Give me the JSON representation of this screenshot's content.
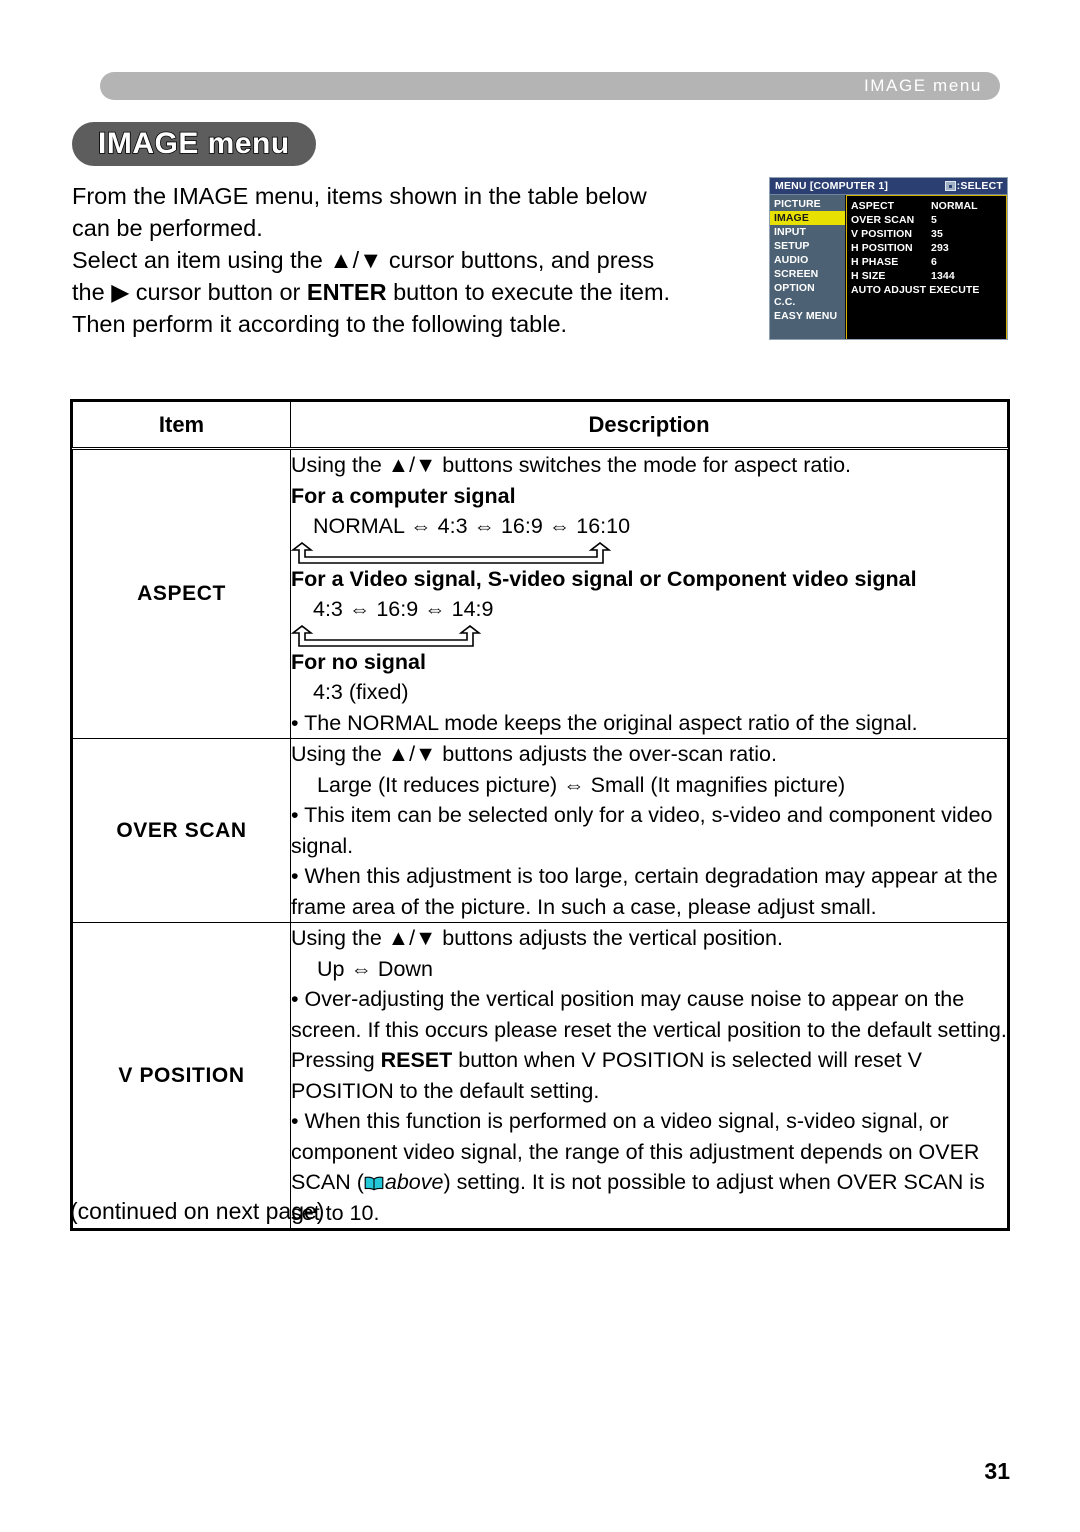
{
  "header": {
    "running_head": "IMAGE menu"
  },
  "page_title": "IMAGE menu",
  "intro": {
    "line1": "From the IMAGE menu, items shown in the table below",
    "line2": "can be performed.",
    "line3a": "Select an item using the ▲/▼ cursor buttons, and press",
    "line4a": "the ▶ cursor button or ",
    "line4b": "ENTER",
    "line4c": " button to execute the item.",
    "line5": "Then perform it according to the following table."
  },
  "osd": {
    "title": "MENU [COMPUTER 1]",
    "select_label": ":SELECT",
    "select_icon": "cursor-pad-icon",
    "sidebar": [
      {
        "label": "PICTURE",
        "selected": false
      },
      {
        "label": "IMAGE",
        "selected": true
      },
      {
        "label": "INPUT",
        "selected": false
      },
      {
        "label": "SETUP",
        "selected": false
      },
      {
        "label": "AUDIO",
        "selected": false
      },
      {
        "label": "SCREEN",
        "selected": false
      },
      {
        "label": "OPTION",
        "selected": false
      },
      {
        "label": "C.C.",
        "selected": false
      },
      {
        "label": "EASY MENU",
        "selected": false
      }
    ],
    "items": [
      {
        "key": "ASPECT",
        "value": "NORMAL"
      },
      {
        "key": "OVER SCAN",
        "value": "5"
      },
      {
        "key": "V POSITION",
        "value": "35"
      },
      {
        "key": "H POSITION",
        "value": "293"
      },
      {
        "key": "H PHASE",
        "value": "6"
      },
      {
        "key": "H SIZE",
        "value": "1344"
      },
      {
        "key": "AUTO ADJUST EXECUTE",
        "value": ""
      }
    ],
    "colors": {
      "titlebar": "#2c3f73",
      "sidebar": "#4c6173",
      "highlight": "#e8e000",
      "panel_border": "#d8b200",
      "panel_bg": "#000000"
    }
  },
  "table": {
    "headers": {
      "item": "Item",
      "description": "Description"
    },
    "rows": [
      {
        "item": "ASPECT",
        "lines": {
          "intro": "Using the ▲/▼ buttons switches the mode for aspect ratio.",
          "sub1": "For a computer signal",
          "seq1": "NORMAL ⇔ 4:3 ⇔ 16:9 ⇔ 16:10",
          "sub2": "For a Video signal, S-video signal or Component video signal",
          "seq2": "4:3 ⇔ 16:9 ⇔ 14:9",
          "sub3": "For no signal",
          "seq3": "4:3 (fixed)",
          "bullet1": "• The NORMAL mode keeps the original aspect ratio of the signal."
        }
      },
      {
        "item": "OVER SCAN",
        "lines": {
          "intro": "Using the ▲/▼ buttons adjusts the over-scan ratio.",
          "seq1": "Large (It reduces picture) ⇔ Small (It magnifies picture)",
          "bullet1": "• This item can be selected only for a video, s-video and component video signal.",
          "bullet2": "• When this adjustment is too large, certain degradation may appear at the frame area of the picture. In such a case, please adjust small."
        }
      },
      {
        "item": "V POSITION",
        "lines": {
          "intro": "Using the ▲/▼ buttons adjusts the vertical position.",
          "seq1": "Up ⇔ Down",
          "bullet1": "• Over-adjusting the vertical position may cause noise to appear on the screen. If this occurs please reset the vertical position to the default setting.",
          "para1a": "Pressing ",
          "para1b": "RESET",
          "para1c": " button when V POSITION is selected will reset V POSITION to the default setting.",
          "bullet2a": "• When this function is performed on a video signal, s-video signal, or component video signal, the range of this adjustment depends on OVER SCAN (",
          "bullet2_ref": "above",
          "bullet2b": ") setting. It is not possible to adjust when OVER SCAN is set to 10."
        }
      }
    ]
  },
  "footer": {
    "continued": "(continued on next page)",
    "page_number": "31"
  }
}
